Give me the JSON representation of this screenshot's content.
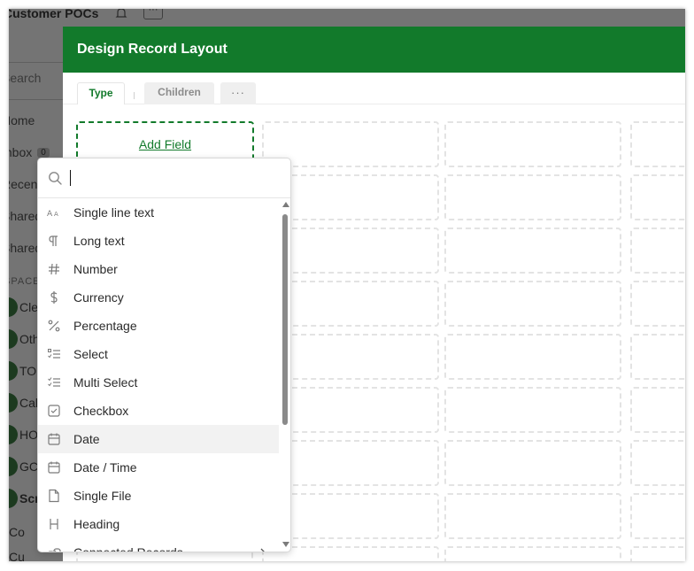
{
  "background": {
    "app_title": "Customer POCs",
    "search_label": "Search",
    "nav_items": [
      {
        "label": "Home"
      },
      {
        "label": "Inbox",
        "badge": "0"
      },
      {
        "label": "Recent"
      },
      {
        "label": "Shared"
      },
      {
        "label": "Shared"
      }
    ],
    "spaces_heading": "SPACES",
    "spaces": [
      {
        "label": "Cle"
      },
      {
        "label": "Oth"
      },
      {
        "label": "TO"
      },
      {
        "label": "Cal"
      },
      {
        "label": "HO"
      },
      {
        "label": "GC"
      },
      {
        "label": "Scr"
      },
      {
        "label": "Co"
      },
      {
        "label": "Cu"
      }
    ]
  },
  "dialog": {
    "title": "Design Record Layout",
    "header_color": "#127a2b",
    "tabs": [
      {
        "label": "Type",
        "active": true
      },
      {
        "label": "Children",
        "active": false
      },
      {
        "label": "···",
        "active": false
      }
    ],
    "add_field_label": "Add Field"
  },
  "field_type_menu": {
    "search": {
      "value": "",
      "placeholder": ""
    },
    "items": [
      {
        "label": "Single line text",
        "icon": "text-size-icon"
      },
      {
        "label": "Long text",
        "icon": "paragraph-icon"
      },
      {
        "label": "Number",
        "icon": "hash-icon"
      },
      {
        "label": "Currency",
        "icon": "dollar-icon"
      },
      {
        "label": "Percentage",
        "icon": "percent-icon"
      },
      {
        "label": "Select",
        "icon": "select-list-icon"
      },
      {
        "label": "Multi Select",
        "icon": "multi-select-list-icon"
      },
      {
        "label": "Checkbox",
        "icon": "checkbox-icon"
      },
      {
        "label": "Date",
        "icon": "calendar-icon",
        "hovered": true
      },
      {
        "label": "Date / Time",
        "icon": "calendar-clock-icon"
      },
      {
        "label": "Single File",
        "icon": "file-icon"
      },
      {
        "label": "Heading",
        "icon": "heading-icon"
      },
      {
        "label": "Connected Records",
        "icon": "link-icon",
        "has_submenu": true
      }
    ]
  }
}
